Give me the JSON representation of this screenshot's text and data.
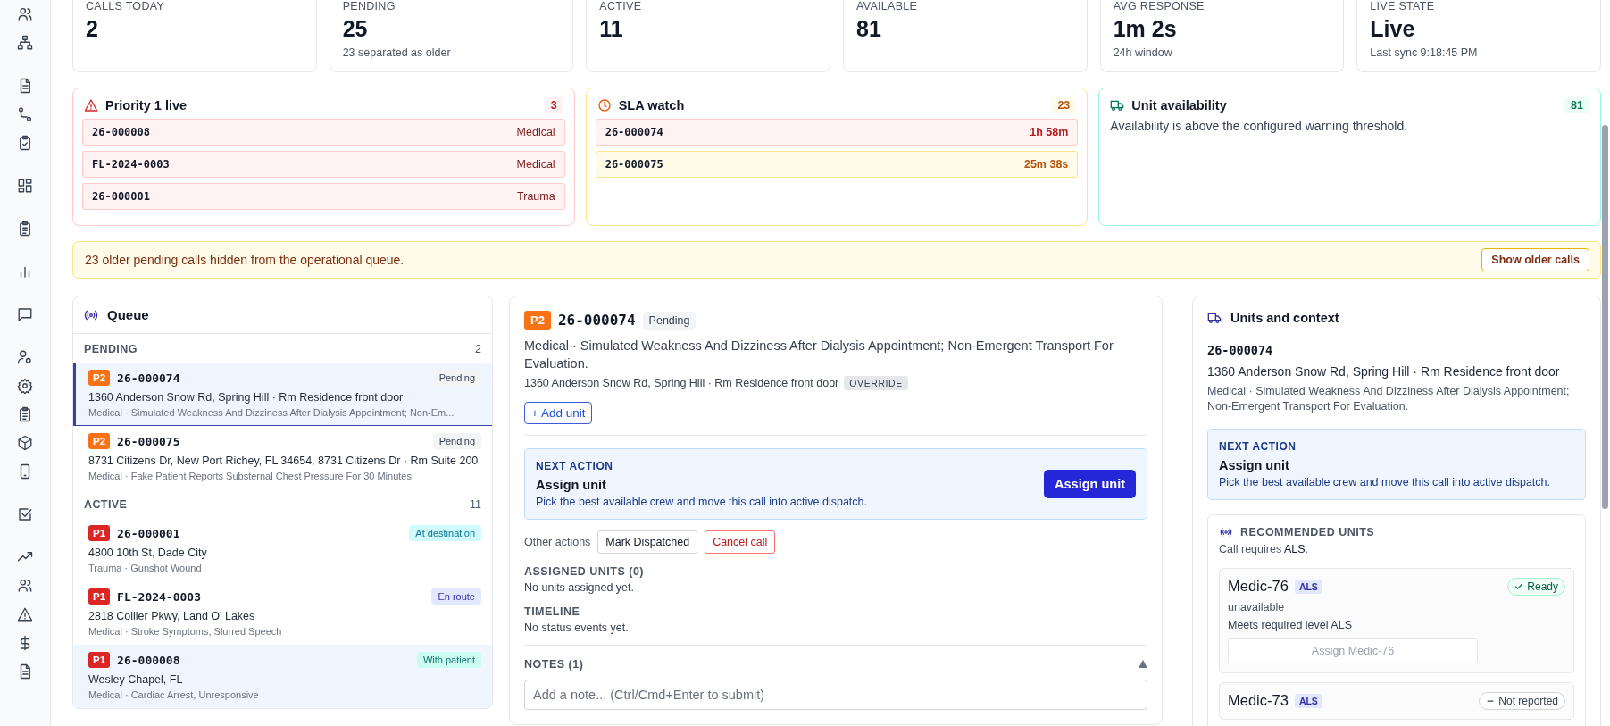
{
  "sidebar": {
    "groups": [
      {
        "items": [
          {
            "kind": "users"
          },
          {
            "kind": "hierarchy"
          }
        ]
      },
      {
        "items": [
          {
            "kind": "document"
          },
          {
            "kind": "route"
          },
          {
            "kind": "clipboard-check"
          }
        ]
      },
      {
        "items": [
          {
            "kind": "grid"
          }
        ]
      },
      {
        "items": [
          {
            "kind": "clipboard"
          }
        ]
      },
      {
        "items": [
          {
            "kind": "bar-chart"
          }
        ]
      },
      {
        "items": [
          {
            "kind": "chat"
          }
        ]
      },
      {
        "items": [
          {
            "kind": "user-gear"
          },
          {
            "kind": "settings"
          },
          {
            "kind": "clipboard"
          },
          {
            "kind": "cube"
          },
          {
            "kind": "phone"
          }
        ]
      },
      {
        "items": [
          {
            "kind": "check-square"
          }
        ]
      },
      {
        "items": [
          {
            "kind": "trend"
          },
          {
            "kind": "users"
          },
          {
            "kind": "warning"
          },
          {
            "kind": "dollar"
          },
          {
            "kind": "document"
          }
        ]
      }
    ]
  },
  "stats": [
    {
      "label": "CALLS TODAY",
      "value": "2"
    },
    {
      "label": "PENDING",
      "value": "25",
      "note": "23 separated as older"
    },
    {
      "label": "ACTIVE",
      "value": "11"
    },
    {
      "label": "AVAILABLE",
      "value": "81"
    },
    {
      "label": "AVG RESPONSE",
      "value": "1m 2s",
      "note": "24h window"
    },
    {
      "label": "LIVE STATE",
      "value": "Live",
      "note": "Last sync 9:18:45 PM"
    }
  ],
  "alerts": [
    {
      "kind": "danger",
      "title": "Priority 1 live",
      "count": "3",
      "rows": [
        {
          "id": "26-000008",
          "detail": "Medical",
          "kind": "critical"
        },
        {
          "id": "FL-2024-0003",
          "detail": "Medical",
          "kind": "critical"
        },
        {
          "id": "26-000001",
          "detail": "Trauma",
          "kind": "critical"
        }
      ]
    },
    {
      "kind": "warning",
      "title": "SLA watch",
      "count": "23",
      "rows": [
        {
          "id": "26-000074",
          "detail": "1h 58m",
          "kind": "critical"
        },
        {
          "id": "26-000075",
          "detail": "25m 38s",
          "kind": "warning"
        }
      ]
    },
    {
      "kind": "ok",
      "title": "Unit availability",
      "count": "81",
      "message": "Availability is above the configured warning threshold."
    }
  ],
  "banner": {
    "text": "23 older pending calls hidden from the operational queue.",
    "button": "Show older calls"
  },
  "queue": {
    "title": "Queue",
    "sections": [
      {
        "label": "PENDING",
        "count": "2",
        "items": [
          {
            "priority": "P2",
            "id": "26-000074",
            "status": "Pending",
            "kind": "pending",
            "address": "1360 Anderson Snow Rd, Spring Hill · Rm Residence front door",
            "description": "Medical · Simulated Weakness And Dizziness After Dialysis Appointment; Non-Em...",
            "selected": true,
            "highlighted": false
          },
          {
            "priority": "P2",
            "id": "26-000075",
            "status": "Pending",
            "kind": "pending",
            "address": "8731 Citizens Dr, New Port Richey, FL 34654, 8731 Citizens Dr · Rm Suite 200",
            "description": "Medical · Fake Patient Reports Substernal Chest Pressure For 30 Minutes.",
            "selected": false,
            "highlighted": false
          }
        ]
      },
      {
        "label": "ACTIVE",
        "count": "11",
        "items": [
          {
            "priority": "P1",
            "id": "26-000001",
            "status": "At destination",
            "kind": "destination",
            "address": "4800 10th St, Dade City",
            "description": "Trauma · Gunshot Wound",
            "selected": false,
            "highlighted": false
          },
          {
            "priority": "P1",
            "id": "FL-2024-0003",
            "status": "En route",
            "kind": "enroute",
            "address": "2818 Collier Pkwy, Land O' Lakes",
            "description": "Medical · Stroke Symptoms, Slurred Speech",
            "selected": false,
            "highlighted": false
          },
          {
            "priority": "P1",
            "id": "26-000008",
            "status": "With patient",
            "kind": "patient",
            "address": "Wesley Chapel, FL",
            "description": "Medical · Cardiac Arrest, Unresponsive",
            "selected": false,
            "highlighted": true
          }
        ]
      }
    ]
  },
  "detail": {
    "priority": "P2",
    "id": "26-000074",
    "status": "Pending",
    "description": "Medical · Simulated Weakness And Dizziness After Dialysis Appointment; Non-Emergent Transport For Evaluation.",
    "address": "1360 Anderson Snow Rd, Spring Hill · Rm Residence front door",
    "address_tag": "OVERRIDE",
    "add_unit": "+ Add unit",
    "next_action": {
      "label": "NEXT ACTION",
      "title": "Assign unit",
      "text": "Pick the best available crew and move this call into active dispatch.",
      "button": "Assign unit"
    },
    "other_actions": {
      "label": "Other actions",
      "buttons": [
        {
          "label": "Mark Dispatched",
          "kind": "default"
        },
        {
          "label": "Cancel call",
          "kind": "danger"
        }
      ]
    },
    "sections": [
      {
        "heading": "ASSIGNED UNITS (0)",
        "text": "No units assigned yet."
      },
      {
        "heading": "TIMELINE",
        "text": "No status events yet."
      }
    ],
    "notes": {
      "heading": "NOTES (1)",
      "expanded": true,
      "placeholder": "Add a note... (Ctrl/Cmd+Enter to submit)"
    }
  },
  "context": {
    "title": "Units and context",
    "id": "26-000074",
    "address": "1360 Anderson Snow Rd, Spring Hill · Rm Residence front door",
    "description": "Medical · Simulated Weakness And Dizziness After Dialysis Appointment; Non-Emergent Transport For Evaluation.",
    "next_action": {
      "label": "NEXT ACTION",
      "title": "Assign unit",
      "text": "Pick the best available crew and move this call into active dispatch."
    },
    "recommended": {
      "heading": "RECOMMENDED UNITS",
      "requirement": "Call requires **ALS**.",
      "units": [
        {
          "name": "Medic-76",
          "level": "ALS",
          "status": "Ready",
          "kind": "ready",
          "availability": "unavailable",
          "match": "Meets required level ALS",
          "button": "Assign Medic-76",
          "disabled": true
        },
        {
          "name": "Medic-73",
          "level": "ALS",
          "status": "Not reported",
          "kind": "unreported"
        }
      ]
    }
  }
}
